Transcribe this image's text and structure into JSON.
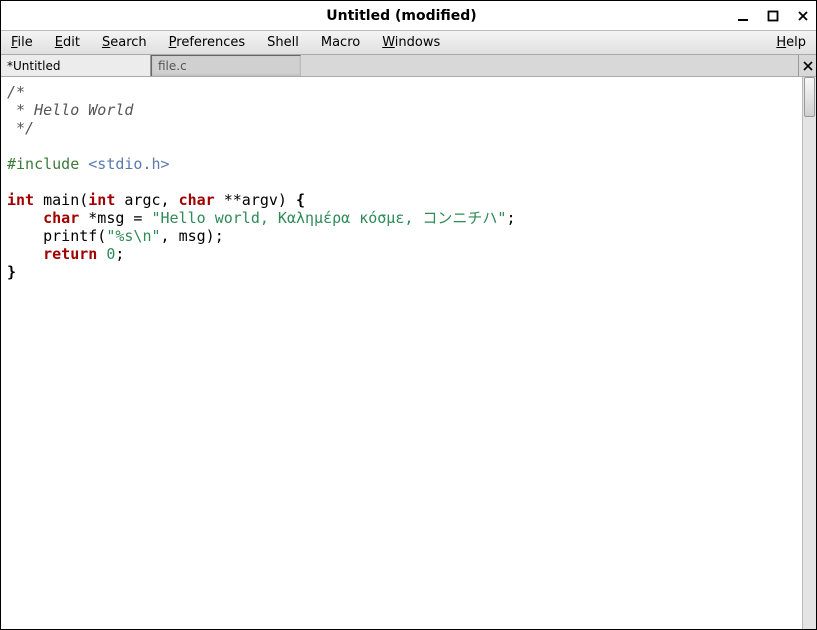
{
  "window": {
    "title": "Untitled (modified)"
  },
  "menubar": {
    "file": {
      "label": "File",
      "ukey": "F",
      "rest": "ile"
    },
    "edit": {
      "label": "Edit",
      "ukey": "E",
      "rest": "dit"
    },
    "search": {
      "label": "Search",
      "ukey": "S",
      "rest": "earch"
    },
    "preferences": {
      "label": "Preferences",
      "ukey": "P",
      "rest": "references"
    },
    "shell": {
      "label": "Shell"
    },
    "macro": {
      "label": "Macro"
    },
    "windows": {
      "label": "Windows",
      "ukey": "W",
      "rest": "indows"
    },
    "help": {
      "label": "Help",
      "ukey": "H",
      "rest": "elp"
    }
  },
  "tabs": {
    "active": {
      "label": "*Untitled"
    },
    "inactive": {
      "label": "file.c"
    }
  },
  "code": {
    "line1": "/*",
    "line2": " * Hello World",
    "line3": " */",
    "line4": "",
    "line5a": "#include ",
    "line5b": "<stdio.h>",
    "line6": "",
    "l7_int": "int",
    "l7_a": " main(",
    "l7_int2": "int",
    "l7_b": " argc, ",
    "l7_char": "char",
    "l7_c": " **argv) ",
    "l7_br": "{",
    "l8_ind": "    ",
    "l8_char": "char",
    "l8_a": " *msg = ",
    "l8_str": "\"Hello world, Καλημέρα κόσμε, コンニチハ\"",
    "l8_b": ";",
    "l9_ind": "    ",
    "l9_a": "printf(",
    "l9_str": "\"%s\\n\"",
    "l9_b": ", msg);",
    "l10_ind": "    ",
    "l10_ret": "return",
    "l10_sp": " ",
    "l10_num": "0",
    "l10_b": ";",
    "l11_br": "}"
  }
}
